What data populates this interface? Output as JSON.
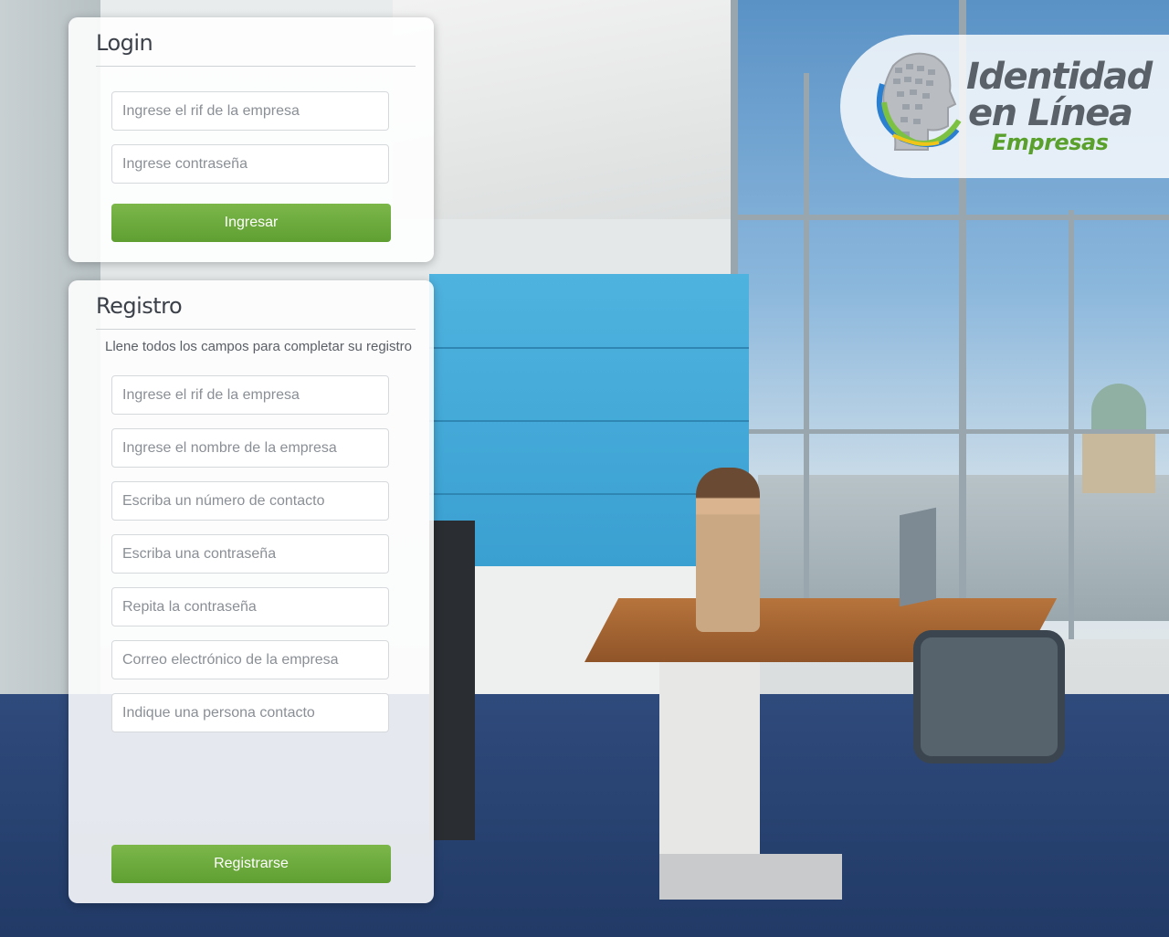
{
  "login": {
    "title": "Login",
    "rif_placeholder": "Ingrese el rif de la empresa",
    "password_placeholder": "Ingrese contraseña",
    "submit_label": "Ingresar"
  },
  "register": {
    "title": "Registro",
    "note": "Llene todos los campos para completar su registro",
    "rif_placeholder": "Ingrese el rif de la empresa",
    "company_name_placeholder": "Ingrese el nombre de la empresa",
    "phone_placeholder": "Escriba un número de contacto",
    "password_placeholder": "Escriba una contraseña",
    "password_repeat_placeholder": "Repita la contraseña",
    "email_placeholder": "Correo electrónico de la empresa",
    "contact_person_placeholder": "Indique una persona contacto",
    "submit_label": "Registrarse"
  },
  "logo": {
    "line1": "Identidad",
    "line2": "en Línea",
    "line3": "Empresas",
    "icon": "head-icon"
  },
  "colors": {
    "accent_green": "#6aa83c",
    "logo_green": "#5aa02c",
    "logo_gray": "#5b6168"
  }
}
